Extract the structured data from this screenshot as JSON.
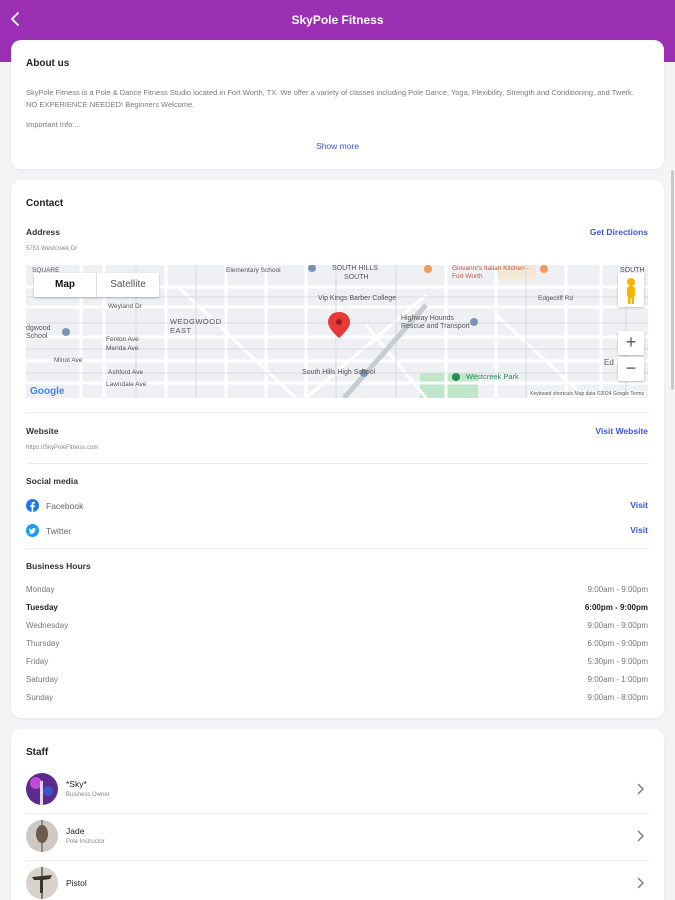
{
  "header": {
    "title": "SkyPole Fitness"
  },
  "about": {
    "title": "About us",
    "description": "SkyPole Fitness is a Pole & Dance Fitness Studio located in Fort Worth, TX. We offer a variety of classes including Pole Dance, Yoga, Flexibility, Strength and Conditioning, and Twerk. NO EXPERIENCE NEEDED! Beginners Welcome.",
    "important": "Important Info:...",
    "show_more": "Show more"
  },
  "contact": {
    "title": "Contact",
    "address_label": "Address",
    "address": "5753 Westcreek Dr",
    "directions": "Get Directions",
    "map": {
      "tab_map": "Map",
      "tab_satellite": "Satellite",
      "zoom_in": "+",
      "zoom_out": "−",
      "google": "Google",
      "attribution": "Keyboard shortcuts   Map data ©2024 Google   Terms",
      "labels": {
        "square": "SQUARE",
        "elementary": "Elementary School",
        "south_hills": "SOUTH HILLS",
        "south": "SOUTH",
        "giovanni": "Giovanni's Italian Kitchen - Fort Worth",
        "south_right": "SOUTH",
        "wedgwood": "WEDGWOOD EAST",
        "vip_kings": "Vip Kings Barber College",
        "highway_hounds": "Highway Hounds Rescue and Transport",
        "south_hills_high": "South Hills High School",
        "westcreek_park": "Westcreek Park",
        "wedgwood_school": "dgwood School",
        "weyland": "Weyland Dr",
        "fenton": "Fenton Ave",
        "merida": "Merida Ave",
        "minot": "Minot Ave",
        "ashford": "Ashford Ave",
        "lawndale": "Lawndale Ave",
        "edgecliff": "Edgecliff Rd",
        "ed": "Ed"
      }
    },
    "website_label": "Website",
    "website": "https://SkyPoleFitness.com",
    "visit_website": "Visit Website",
    "social_label": "Social media",
    "social": [
      {
        "name": "Facebook",
        "action": "Visit",
        "icon": "facebook-icon",
        "color": "#1877f2"
      },
      {
        "name": "Twitter",
        "action": "Visit",
        "icon": "twitter-icon",
        "color": "#1d9bf0"
      }
    ],
    "hours_label": "Business Hours",
    "hours": [
      {
        "day": "Monday",
        "time": "9:00am - 9:00pm"
      },
      {
        "day": "Tuesday",
        "time": "6:00pm - 9:00pm"
      },
      {
        "day": "Wednesday",
        "time": "9:00am - 9:00pm"
      },
      {
        "day": "Thursday",
        "time": "6:00pm - 9:00pm"
      },
      {
        "day": "Friday",
        "time": "5:30pm - 9:00pm"
      },
      {
        "day": "Saturday",
        "time": "9:00am - 1:00pm"
      },
      {
        "day": "Sunday",
        "time": "9:00am - 8:00pm"
      }
    ]
  },
  "staff": {
    "title": "Staff",
    "members": [
      {
        "name": "*Sky*",
        "role": "Business Owner"
      },
      {
        "name": "Jade",
        "role": "Pole Instructor"
      },
      {
        "name": "Pistol",
        "role": ""
      }
    ]
  },
  "colors": {
    "header": "#9b2fb3",
    "link": "#3b55d9",
    "pin": "#e53935"
  }
}
